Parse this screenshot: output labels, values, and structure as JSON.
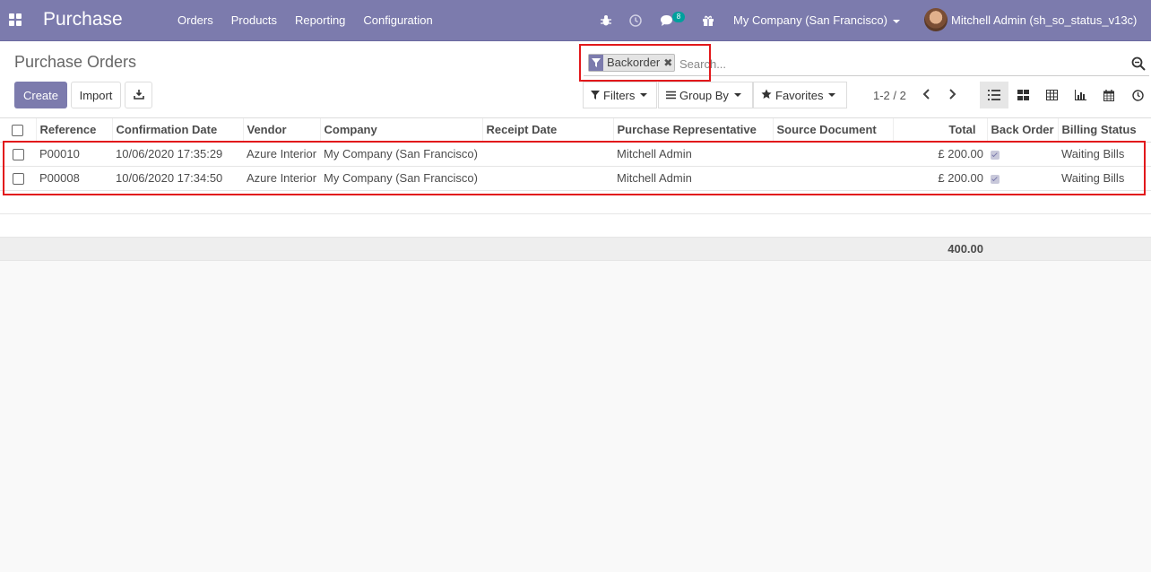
{
  "navbar": {
    "app_name": "Purchase",
    "menu": [
      "Orders",
      "Products",
      "Reporting",
      "Configuration"
    ],
    "chat_badge": "8",
    "company": "My Company (San Francisco)",
    "user": "Mitchell Admin (sh_so_status_v13c)",
    "colors": {
      "brand": "#7c7bad",
      "badge": "#00a09d"
    }
  },
  "control_panel": {
    "title": "Purchase Orders",
    "create_label": "Create",
    "import_label": "Import",
    "search": {
      "facet_value": "Backorder",
      "placeholder": "Search..."
    },
    "filters_label": "Filters",
    "group_by_label": "Group By",
    "favorites_label": "Favorites",
    "pager": "1-2 / 2",
    "views": [
      "list",
      "kanban",
      "pivot",
      "graph",
      "calendar",
      "activity"
    ],
    "active_view": "list"
  },
  "table": {
    "columns": [
      "Reference",
      "Confirmation Date",
      "Vendor",
      "Company",
      "Receipt Date",
      "Purchase Representative",
      "Source Document",
      "Total",
      "Back Order",
      "Billing Status"
    ],
    "rows": [
      {
        "reference": "P00010",
        "confirmation_date": "10/06/2020 17:35:29",
        "vendor": "Azure Interior",
        "company": "My Company (San Francisco)",
        "receipt_date": "",
        "representative": "Mitchell Admin",
        "source": "",
        "total": "£ 200.00",
        "back_order": true,
        "billing_status": "Waiting Bills"
      },
      {
        "reference": "P00008",
        "confirmation_date": "10/06/2020 17:34:50",
        "vendor": "Azure Interior",
        "company": "My Company (San Francisco)",
        "receipt_date": "",
        "representative": "Mitchell Admin",
        "source": "",
        "total": "£ 200.00",
        "back_order": true,
        "billing_status": "Waiting Bills"
      }
    ],
    "footer_total": "400.00"
  },
  "highlight_color": "#e2181b"
}
